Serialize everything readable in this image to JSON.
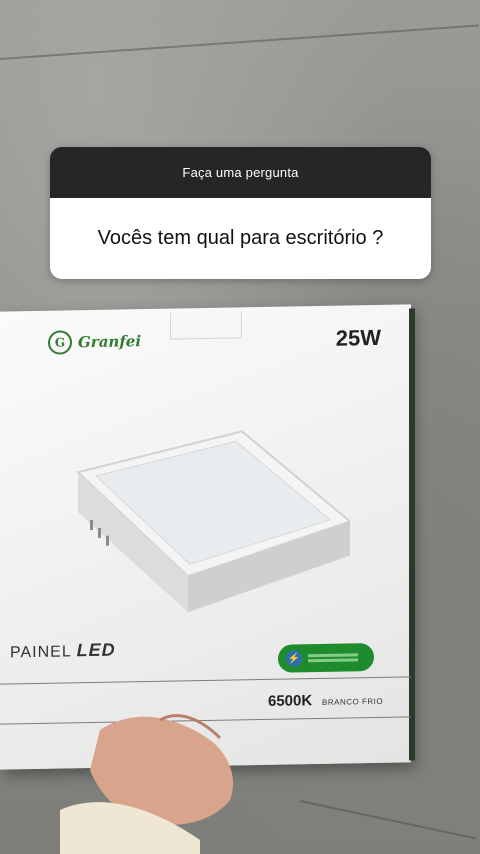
{
  "question_sticker": {
    "header": "Faça uma pergunta",
    "question": "Vocês tem qual para escritório ?"
  },
  "product_box": {
    "brand": "Granfei",
    "wattage": "25W",
    "product_name_prefix": "PAINEL",
    "product_name_suffix": "LED",
    "color_temperature": "6500K",
    "color_label": "BRANCO FRIO"
  },
  "colors": {
    "sticker_header": "#262626",
    "brand_green": "#2f7d32",
    "badge_green": "#1e8b2c"
  }
}
